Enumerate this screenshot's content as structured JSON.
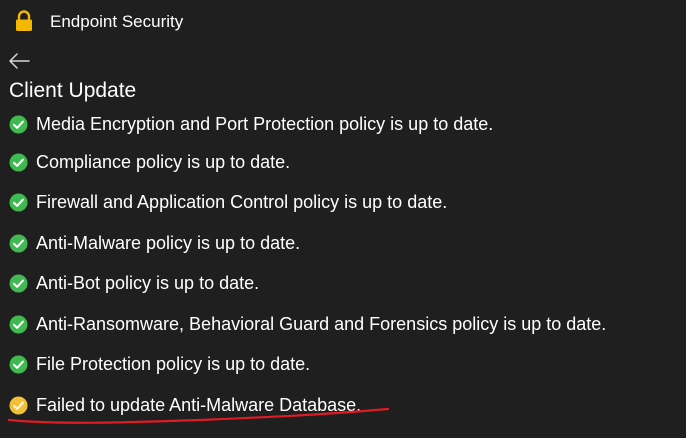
{
  "window": {
    "title": "Endpoint Security",
    "lock_icon": "lock-icon",
    "background": "#1f1f1f"
  },
  "page": {
    "title": "Client Update",
    "back_icon": "arrow-left-icon"
  },
  "status_items": [
    {
      "text": "Media Encryption and Port Protection policy is up to date.",
      "status": "success",
      "icon": "check-circle-icon"
    },
    {
      "text": "Compliance policy is up to date.",
      "status": "success",
      "icon": "check-circle-icon"
    },
    {
      "text": "Firewall and Application Control policy is up to date.",
      "status": "success",
      "icon": "check-circle-icon"
    },
    {
      "text": "Anti-Malware policy is up to date.",
      "status": "success",
      "icon": "check-circle-icon"
    },
    {
      "text": "Anti-Bot policy is up to date.",
      "status": "success",
      "icon": "check-circle-icon"
    },
    {
      "text": "Anti-Ransomware, Behavioral Guard and Forensics policy is up to date.",
      "status": "success",
      "icon": "check-circle-icon"
    },
    {
      "text": "File Protection policy is up to date.",
      "status": "success",
      "icon": "check-circle-icon"
    },
    {
      "text": "Failed to update Anti-Malware Database.",
      "status": "warning",
      "icon": "warning-circle-icon"
    }
  ],
  "colors": {
    "success": "#3fb950",
    "warning": "#f2c037",
    "lock": "#f5b800",
    "annotation": "#e01b24"
  }
}
